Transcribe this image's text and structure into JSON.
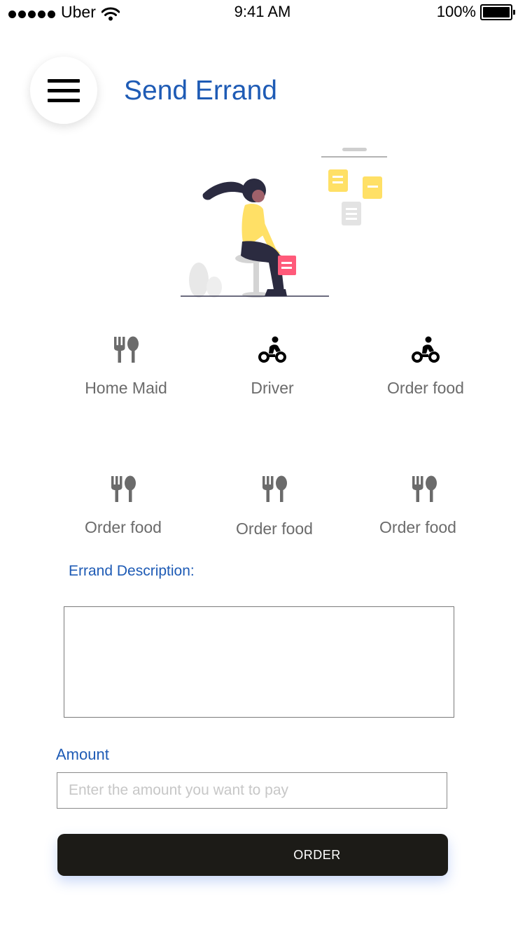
{
  "status_bar": {
    "carrier": "Uber",
    "time": "9:41 AM",
    "battery": "100%"
  },
  "header": {
    "title": "Send Errand",
    "menu_icon": "hamburger-menu-icon"
  },
  "services": [
    {
      "label": "Home Maid",
      "icon": "utensils-icon",
      "icon_color": "#6b6b6b"
    },
    {
      "label": "Driver",
      "icon": "motorbike-rider-icon",
      "icon_color": "#000000"
    },
    {
      "label": "Order food",
      "icon": "motorbike-rider-icon",
      "icon_color": "#000000"
    },
    {
      "label": "Order food",
      "icon": "utensils-icon",
      "icon_color": "#6b6b6b"
    },
    {
      "label": "Order food",
      "icon": "utensils-icon",
      "icon_color": "#6b6b6b"
    },
    {
      "label": "Order food",
      "icon": "utensils-icon",
      "icon_color": "#6b6b6b"
    }
  ],
  "form": {
    "description_label": "Errand Description:",
    "description_value": "",
    "amount_label": "Amount",
    "amount_placeholder": "Enter the amount you want to pay",
    "amount_value": "",
    "order_button": "ORDER"
  },
  "colors": {
    "accent": "#1e5bb5",
    "button_bg": "#1c1b17",
    "label_gray": "#6b6b6b",
    "illustration_yellow": "#ffe066",
    "illustration_pink": "#ff5a7a"
  }
}
